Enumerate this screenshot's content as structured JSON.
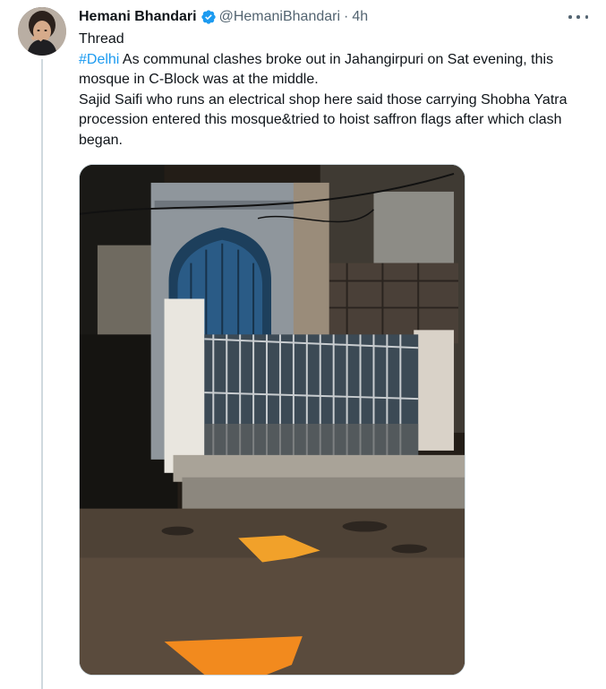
{
  "author": {
    "name": "Hemani Bhandari",
    "handle": "@HemaniBhandari",
    "separator": "·",
    "time": "4h",
    "verified": true
  },
  "tweet": {
    "label": "Thread",
    "hashtag": "#Delhi",
    "line1": " As communal clashes broke out in Jahangirpuri on Sat evening, this mosque in C-Block was at the middle.",
    "line2": "Sajid Saifi who runs an electrical shop here said those carrying Shobha Yatra procession entered this mosque&tried to hoist saffron flags after which clash began."
  },
  "icons": {
    "more": "more-horizontal-icon",
    "verified": "verified-badge-icon"
  },
  "colors": {
    "accent": "#1d9bf0",
    "text": "#0f1419",
    "secondary": "#536471",
    "thread_line": "#cfd9de"
  }
}
